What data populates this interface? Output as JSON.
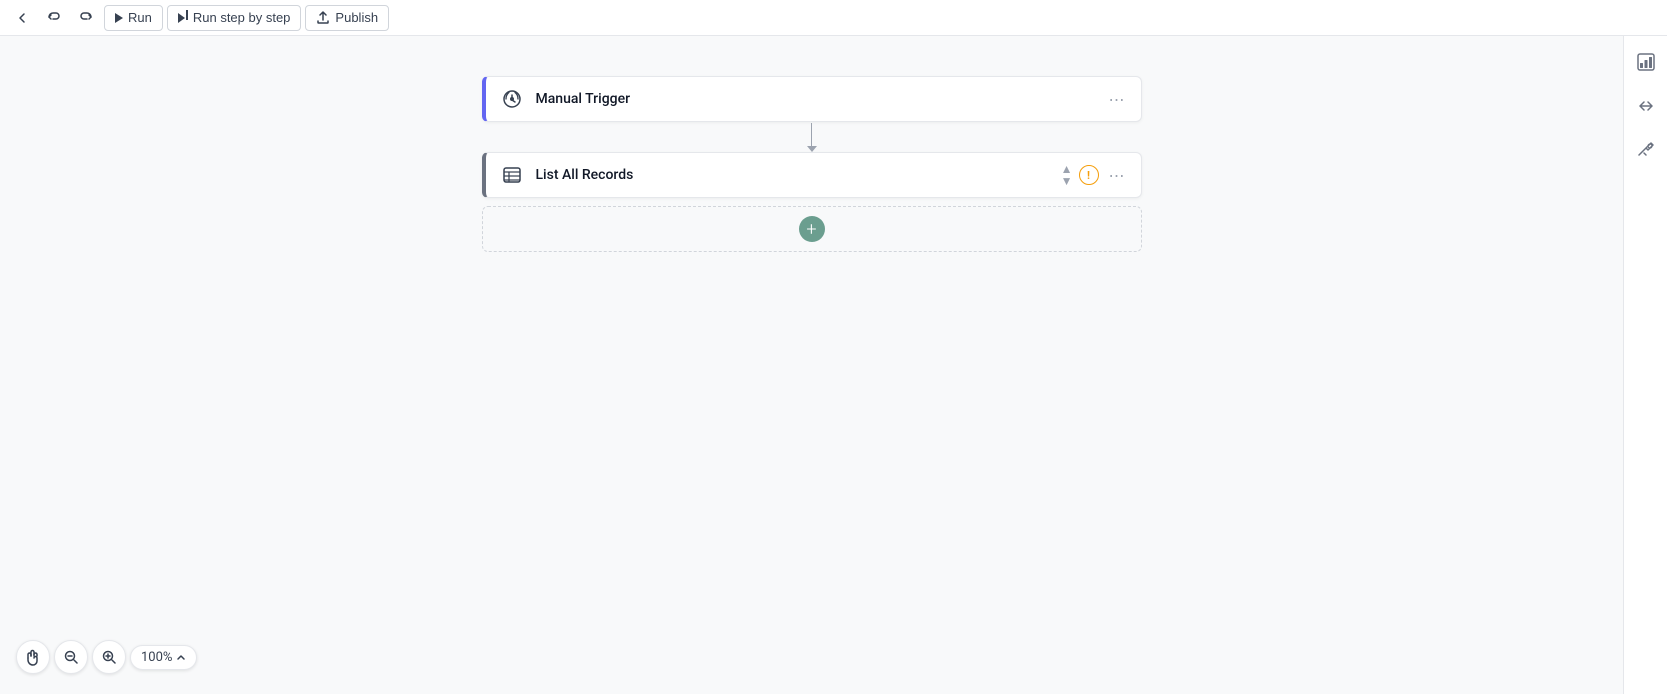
{
  "toolbar": {
    "undo_label": "↩",
    "redo_label": "↪",
    "run_label": "Run",
    "run_step_label": "Run step by step",
    "publish_label": "Publish"
  },
  "workflow": {
    "trigger_node": {
      "label": "Manual Trigger",
      "icon": "✋"
    },
    "action_node": {
      "label": "List All Records",
      "icon": "☰"
    },
    "add_step_label": "+"
  },
  "zoom": {
    "level": "100%"
  },
  "right_sidebar": {
    "icons": [
      "📊",
      "🔗",
      "🔭"
    ]
  }
}
